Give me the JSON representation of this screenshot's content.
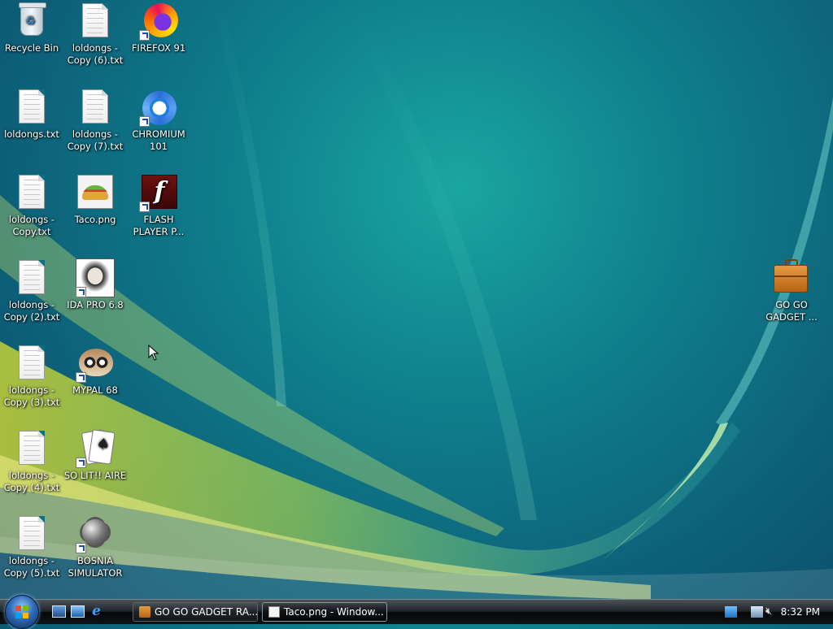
{
  "desktop": {
    "icons": [
      {
        "label": "Recycle Bin"
      },
      {
        "label": "loldongs - Copy (6).txt"
      },
      {
        "label": "FIREFOX 91"
      },
      {
        "label": "loldongs.txt"
      },
      {
        "label": "loldongs - Copy (7).txt"
      },
      {
        "label": "CHROMIUM 101"
      },
      {
        "label": "loldongs - Copy.txt"
      },
      {
        "label": "Taco.png"
      },
      {
        "label": "FLASH PLAYER P..."
      },
      {
        "label": "loldongs - Copy (2).txt"
      },
      {
        "label": "IDA PRO 6.8"
      },
      {
        "label": "loldongs - Copy (3).txt"
      },
      {
        "label": "MYPAL 68"
      },
      {
        "label": "loldongs - Copy (4).txt"
      },
      {
        "label": "SO LIT!! AIRE"
      },
      {
        "label": "loldongs - Copy (5).txt"
      },
      {
        "label": "BOSNIA SIMULATOR"
      },
      {
        "label": "GO GO GADGET ..."
      }
    ]
  },
  "taskbar": {
    "buttons": [
      {
        "label": "GO GO GADGET RA..."
      },
      {
        "label": "Taco.png - Window..."
      }
    ],
    "clock": "8:32 PM"
  }
}
